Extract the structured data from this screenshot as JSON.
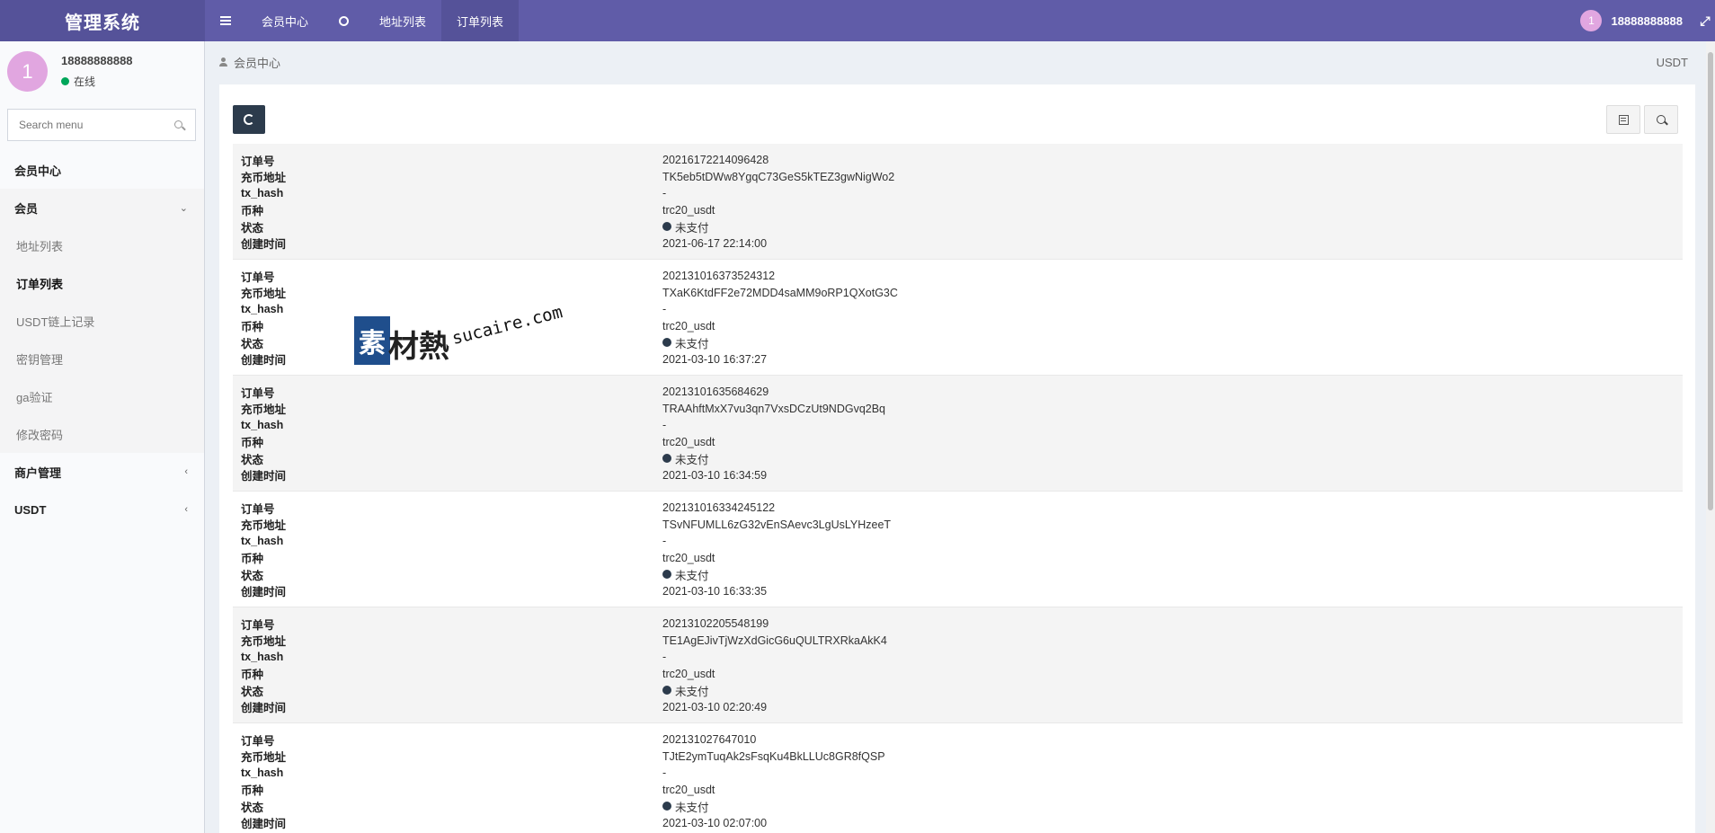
{
  "header": {
    "brand": "管理系统",
    "nav": [
      {
        "label": "会员中心"
      },
      {
        "label": "地址列表"
      },
      {
        "label": "订单列表"
      }
    ],
    "user": {
      "avatar_text": "1",
      "name": "18888888888"
    }
  },
  "sidebar": {
    "user": {
      "avatar_text": "1",
      "name": "18888888888",
      "status": "在线"
    },
    "search_placeholder": "Search menu",
    "menu": {
      "home": "会员中心",
      "member": "会员",
      "sub": [
        "地址列表",
        "订单列表",
        "USDT链上记录",
        "密钥管理",
        "ga验证",
        "修改密码"
      ],
      "merchant": "商户管理",
      "usdt": "USDT"
    }
  },
  "breadcrumb": {
    "current": "会员中心",
    "right_label": "USDT"
  },
  "field_labels": {
    "order_no": "订单号",
    "address": "充币地址",
    "tx_hash": "tx_hash",
    "coin": "币种",
    "status": "状态",
    "created": "创建时间"
  },
  "orders": [
    {
      "order_no": "20216172214096428",
      "address": "TK5eb5tDWw8YgqC73GeS5kTEZ3gwNigWo2",
      "tx_hash": "-",
      "coin": "trc20_usdt",
      "status": "未支付",
      "created": "2021-06-17 22:14:00"
    },
    {
      "order_no": "202131016373524312",
      "address": "TXaK6KtdFF2e72MDD4saMM9oRP1QXotG3C",
      "tx_hash": "-",
      "coin": "trc20_usdt",
      "status": "未支付",
      "created": "2021-03-10 16:37:27"
    },
    {
      "order_no": "20213101635684629",
      "address": "TRAAhftMxX7vu3qn7VxsDCzUt9NDGvq2Bq",
      "tx_hash": "-",
      "coin": "trc20_usdt",
      "status": "未支付",
      "created": "2021-03-10 16:34:59"
    },
    {
      "order_no": "202131016334245122",
      "address": "TSvNFUMLL6zG32vEnSAevc3LgUsLYHzeeT",
      "tx_hash": "-",
      "coin": "trc20_usdt",
      "status": "未支付",
      "created": "2021-03-10 16:33:35"
    },
    {
      "order_no": "20213102205548199",
      "address": "TE1AgEJivTjWzXdGicG6uQULTRXRkaAkK4",
      "tx_hash": "-",
      "coin": "trc20_usdt",
      "status": "未支付",
      "created": "2021-03-10 02:20:49"
    },
    {
      "order_no": "202131027647010",
      "address": "TJtE2ymTuqAk2sFsqKu4BkLLUc8GR8fQSP",
      "tx_hash": "-",
      "coin": "trc20_usdt",
      "status": "未支付",
      "created": "2021-03-10 02:07:00"
    }
  ],
  "watermark": {
    "logo": "素",
    "name": "材熱",
    "url": "sucaire.com"
  },
  "colors": {
    "header": "#605ca8",
    "header_dark": "#555299",
    "status_dot": "#2c3b4c",
    "online": "#00a65a",
    "avatar": "#e1a6e0"
  }
}
